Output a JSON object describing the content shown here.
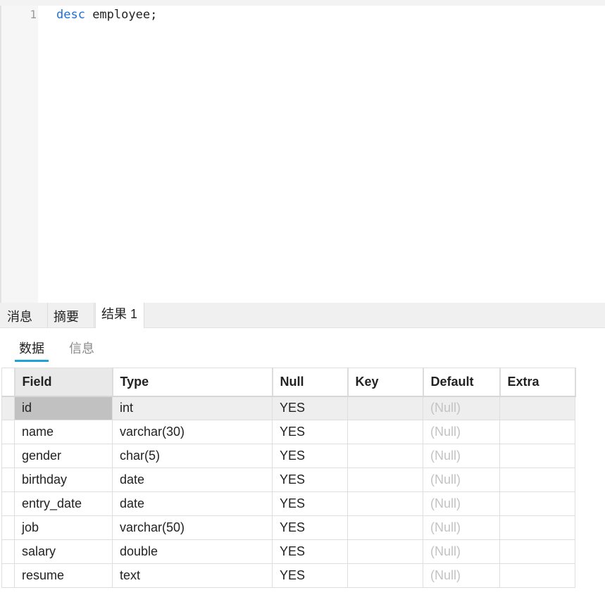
{
  "editor": {
    "line_number": "1",
    "code_keyword": "desc",
    "code_rest": " employee;"
  },
  "result_tabs": {
    "messages": "消息",
    "summary": "摘要",
    "result": "结果 1"
  },
  "sub_tabs": {
    "data": "数据",
    "info": "信息"
  },
  "grid": {
    "columns": [
      "Field",
      "Type",
      "Null",
      "Key",
      "Default",
      "Extra"
    ],
    "rows": [
      [
        "id",
        "int",
        "YES",
        "",
        "(Null)",
        ""
      ],
      [
        "name",
        "varchar(30)",
        "YES",
        "",
        "(Null)",
        ""
      ],
      [
        "gender",
        "char(5)",
        "YES",
        "",
        "(Null)",
        ""
      ],
      [
        "birthday",
        "date",
        "YES",
        "",
        "(Null)",
        ""
      ],
      [
        "entry_date",
        "date",
        "YES",
        "",
        "(Null)",
        ""
      ],
      [
        "job",
        "varchar(50)",
        "YES",
        "",
        "(Null)",
        ""
      ],
      [
        "salary",
        "double",
        "YES",
        "",
        "(Null)",
        ""
      ],
      [
        "resume",
        "text",
        "YES",
        "",
        "(Null)",
        ""
      ]
    ]
  }
}
